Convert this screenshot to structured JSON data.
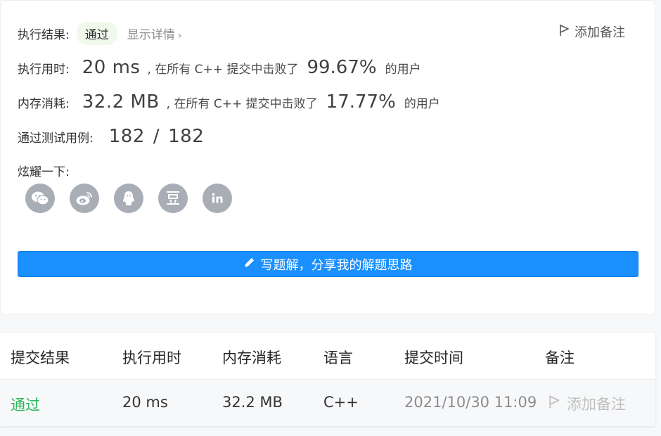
{
  "result": {
    "label": "执行结果:",
    "status": "通过",
    "details_link": "显示详情",
    "add_note": "添加备注"
  },
  "runtime": {
    "label": "执行用时:",
    "value": "20 ms",
    "beat_prefix": ", 在所有 C++ 提交中击败了",
    "percent": "99.67%",
    "suffix": "的用户"
  },
  "memory": {
    "label": "内存消耗:",
    "value": "32.2 MB",
    "beat_prefix": ", 在所有 C++ 提交中击败了",
    "percent": "17.77%",
    "suffix": "的用户"
  },
  "testcases": {
    "label": "通过测试用例:",
    "passed": "182",
    "sep": "/",
    "total": "182"
  },
  "share": {
    "label": "炫耀一下:",
    "icons": [
      "wechat-icon",
      "weibo-icon",
      "qq-icon",
      "douban-icon",
      "linkedin-icon"
    ]
  },
  "write_solution_button": "写题解，分享我的解题思路",
  "table": {
    "headers": [
      "提交结果",
      "执行用时",
      "内存消耗",
      "语言",
      "提交时间",
      "备注"
    ],
    "row": {
      "status": "通过",
      "runtime": "20 ms",
      "memory": "32.2 MB",
      "language": "C++",
      "submitted_at": "2021/10/30 11:09",
      "note": "添加备注"
    }
  },
  "colors": {
    "accent": "#1a90ff",
    "success": "#2db55d",
    "icon_bg": "#a9adb5"
  }
}
